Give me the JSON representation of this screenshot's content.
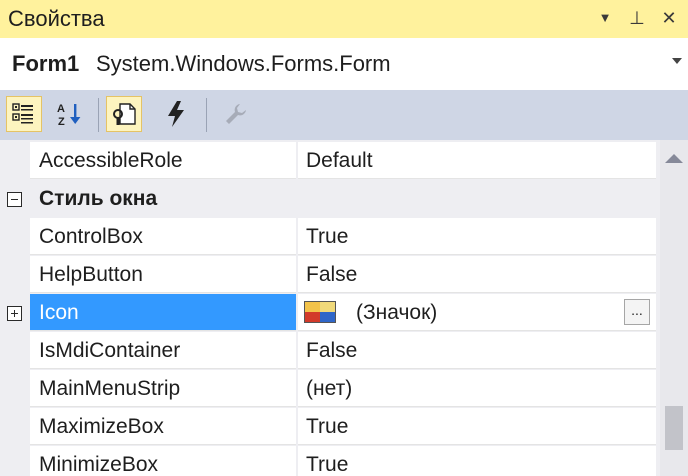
{
  "window": {
    "title": "Свойства",
    "buttons": {
      "dropdown": "▼",
      "pin": "⊥",
      "close": "✕"
    }
  },
  "object_selector": {
    "name": "Form1",
    "type": "System.Windows.Forms.Form"
  },
  "toolbar": {
    "tools": [
      {
        "icon": "categorized-icon",
        "active": true
      },
      {
        "icon": "alphabetical-sort-icon",
        "active": false
      },
      {
        "icon": "properties-icon",
        "active": true
      },
      {
        "icon": "events-lightning-icon",
        "active": false
      },
      {
        "icon": "property-pages-wrench-icon",
        "active": false
      }
    ]
  },
  "grid": {
    "rows": [
      {
        "kind": "property",
        "name": "AccessibleRole",
        "value": "Default"
      },
      {
        "kind": "category",
        "name": "Стиль окна",
        "expanded": true
      },
      {
        "kind": "property",
        "name": "ControlBox",
        "value": "True"
      },
      {
        "kind": "property",
        "name": "HelpButton",
        "value": "False"
      },
      {
        "kind": "property",
        "name": "Icon",
        "value": "(Значок)",
        "selected": true,
        "expandable": true,
        "button": "..."
      },
      {
        "kind": "property",
        "name": "IsMdiContainer",
        "value": "False"
      },
      {
        "kind": "property",
        "name": "MainMenuStrip",
        "value": "(нет)"
      },
      {
        "kind": "property",
        "name": "MaximizeBox",
        "value": "True"
      },
      {
        "kind": "property",
        "name": "MinimizeBox",
        "value": "True"
      }
    ]
  },
  "colors": {
    "title_bg": "#fff29d",
    "toolbar_bg": "#cfd6e5",
    "selection": "#3399ff",
    "category_bg": "#eeeef2"
  }
}
